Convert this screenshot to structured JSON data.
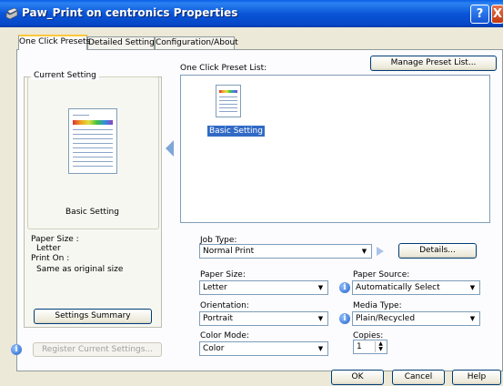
{
  "window": {
    "title": "Paw_Print on centronics Properties",
    "help_glyph": "?",
    "close_glyph": "X"
  },
  "tabs": [
    {
      "label": "One Click Presets",
      "active": true
    },
    {
      "label": "Detailed Settings",
      "active": false
    },
    {
      "label": "Configuration/About",
      "active": false
    }
  ],
  "left": {
    "group_title": "Current Setting",
    "setting_name": "Basic Setting",
    "paper_size_label": "Paper Size :",
    "paper_size_value": "Letter",
    "print_on_label": "Print On :",
    "print_on_value": "Same as original size",
    "summary_button": "Settings Summary",
    "register_button": "Register Current Settings...",
    "info_glyph": "i"
  },
  "presets": {
    "list_label": "One Click Preset List:",
    "manage_button": "Manage Preset List...",
    "items": [
      {
        "label": "Basic Setting",
        "selected": true
      }
    ]
  },
  "form": {
    "job_type_label": "Job Type:",
    "job_type_value": "Normal Print",
    "details_button": "Details...",
    "paper_size_label": "Paper Size:",
    "paper_size_value": "Letter",
    "paper_source_label": "Paper Source:",
    "paper_source_value": "Automatically Select",
    "orientation_label": "Orientation:",
    "orientation_value": "Portrait",
    "media_type_label": "Media Type:",
    "media_type_value": "Plain/Recycled",
    "color_mode_label": "Color Mode:",
    "color_mode_value": "Color",
    "copies_label": "Copies:",
    "copies_value": "1"
  },
  "footer": {
    "ok": "OK",
    "cancel": "Cancel",
    "help": "Help"
  },
  "colors": {
    "selection": "#316ac5",
    "titlebar": "#0a55d8",
    "tab_highlight": "#ffc83c"
  }
}
